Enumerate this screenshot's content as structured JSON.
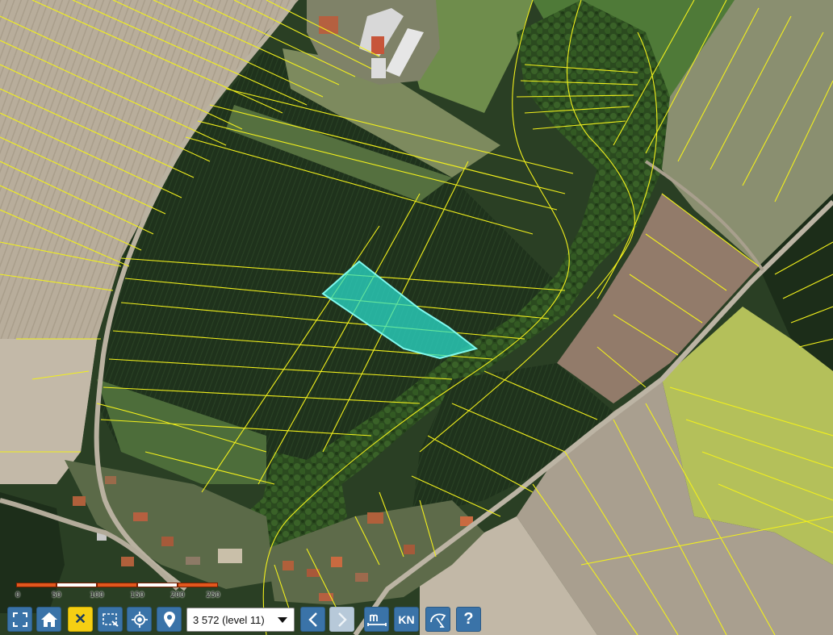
{
  "map": {
    "colors": {
      "parcel_line": "#f2f01c",
      "selected_fill": "#2be0d0",
      "selected_stroke": "#7ff8ee",
      "dark_field": "#1d2e1a",
      "light_field": "#b4a896",
      "forest": "#2c4a1e",
      "yellow_crop": "#b6c25c"
    }
  },
  "scalebar": {
    "labels": [
      "0",
      "50",
      "100",
      "150",
      "200",
      "250"
    ],
    "colors": {
      "orange": "#e2571e",
      "white": "#ffffff"
    }
  },
  "toolbar": {
    "fullscreen_icon": "fullscreen-icon",
    "home_icon": "home-icon",
    "clear_label": "✕",
    "select_area_icon": "select-area-icon",
    "locate_icon": "crosshair-icon",
    "marker_icon": "map-marker-icon",
    "scale_select_value": "3 572 (level 11)",
    "prev_icon": "chevron-left-icon",
    "next_icon": "chevron-right-icon",
    "measure_icon": "measure-icon",
    "kn_label": "KN",
    "polygon_icon": "polygon-tool-icon",
    "help_label": "?",
    "accent": "#3a73a8",
    "active_color": "#f5cf13"
  }
}
